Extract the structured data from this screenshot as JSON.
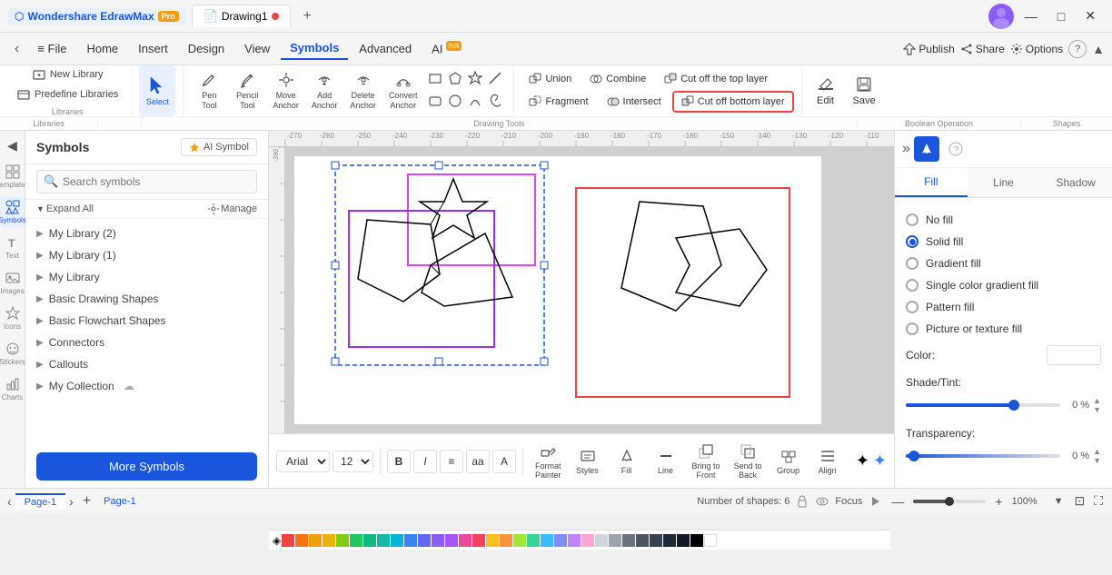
{
  "app": {
    "name": "Wondershare EdrawMax",
    "badge": "Pro",
    "tab_title": "Drawing1",
    "tab_dot_color": "#ef4444"
  },
  "titlebar": {
    "win_minimize": "—",
    "win_maximize": "□",
    "win_close": "✕"
  },
  "menubar": {
    "items": [
      "Home",
      "Insert",
      "Design",
      "View",
      "Symbols",
      "Advanced",
      "AI"
    ],
    "active": "Symbols",
    "ai_badge": "hot",
    "publish": "Publish",
    "share": "Share",
    "options": "Options",
    "collapse": "▲"
  },
  "toolbar": {
    "libraries_label": "Libraries",
    "new_library": "New Library",
    "predefine_libraries": "Predefine Libraries",
    "select_label": "Select",
    "pen_tool_label": "Pen\nTool",
    "pencil_tool_label": "Pencil\nTool",
    "move_anchor_label": "Move\nAnchor",
    "add_anchor_label": "Add\nAnchor",
    "delete_anchor_label": "Delete\nAnchor",
    "convert_anchor_label": "Convert\nAnchor",
    "drawing_tools_label": "Drawing Tools",
    "union_label": "Union",
    "combine_label": "Combine",
    "cut_top_label": "Cut off the top layer",
    "fragment_label": "Fragment",
    "intersect_label": "Intersect",
    "cut_bottom_label": "Cut off bottom layer",
    "boolean_label": "Boolean Operation",
    "edit_label": "Edit",
    "save_label": "Save",
    "shapes_label": "Shapes"
  },
  "sidebar": {
    "title": "Symbols",
    "ai_btn": "AI Symbol",
    "search_placeholder": "Search symbols",
    "expand_all": "Expand All",
    "manage": "Manage",
    "items": [
      {
        "label": "My Library (2)",
        "arrow": "▶"
      },
      {
        "label": "My Library (1)",
        "arrow": "▶"
      },
      {
        "label": "My Library",
        "arrow": "▶"
      },
      {
        "label": "Basic Drawing Shapes",
        "arrow": "▶"
      },
      {
        "label": "Basic Flowchart Shapes",
        "arrow": "▶"
      },
      {
        "label": "Connectors",
        "arrow": "▶"
      },
      {
        "label": "Callouts",
        "arrow": "▶"
      },
      {
        "label": "My Collection",
        "arrow": "▶"
      }
    ],
    "more_symbols": "More Symbols"
  },
  "bottom_toolbar": {
    "font": "Arial",
    "font_size": "12",
    "bold": "B",
    "italic": "I",
    "align": "≡",
    "aa": "aa",
    "AA": "A",
    "format_painter": "Format\nPainter",
    "styles": "Styles",
    "fill": "Fill",
    "line": "Line",
    "bring_to_front": "Bring to\nFront",
    "send_to_back": "Send to\nBack",
    "group": "Group",
    "align_btn": "Align",
    "sparkle": "✦"
  },
  "right_panel": {
    "tabs": [
      "Fill",
      "Line",
      "Shadow"
    ],
    "active_tab": "Fill",
    "fill_options": [
      {
        "id": "no_fill",
        "label": "No fill",
        "selected": false
      },
      {
        "id": "solid_fill",
        "label": "Solid fill",
        "selected": true
      },
      {
        "id": "gradient_fill",
        "label": "Gradient fill",
        "selected": false
      },
      {
        "id": "single_color_gradient",
        "label": "Single color gradient fill",
        "selected": false
      },
      {
        "id": "pattern_fill",
        "label": "Pattern fill",
        "selected": false
      },
      {
        "id": "picture_fill",
        "label": "Picture or texture fill",
        "selected": false
      }
    ],
    "color_label": "Color:",
    "shade_tint_label": "Shade/Tint:",
    "shade_pct": "0 %",
    "shade_value": 70,
    "transparency_label": "Transparency:",
    "transparency_pct": "0 %",
    "transparency_value": 5
  },
  "status_bar": {
    "shapes_count": "Number of shapes: 6",
    "focus": "Focus",
    "page1_tab": "Page-1",
    "page1_bottom": "Page-1",
    "zoom": "100%"
  }
}
